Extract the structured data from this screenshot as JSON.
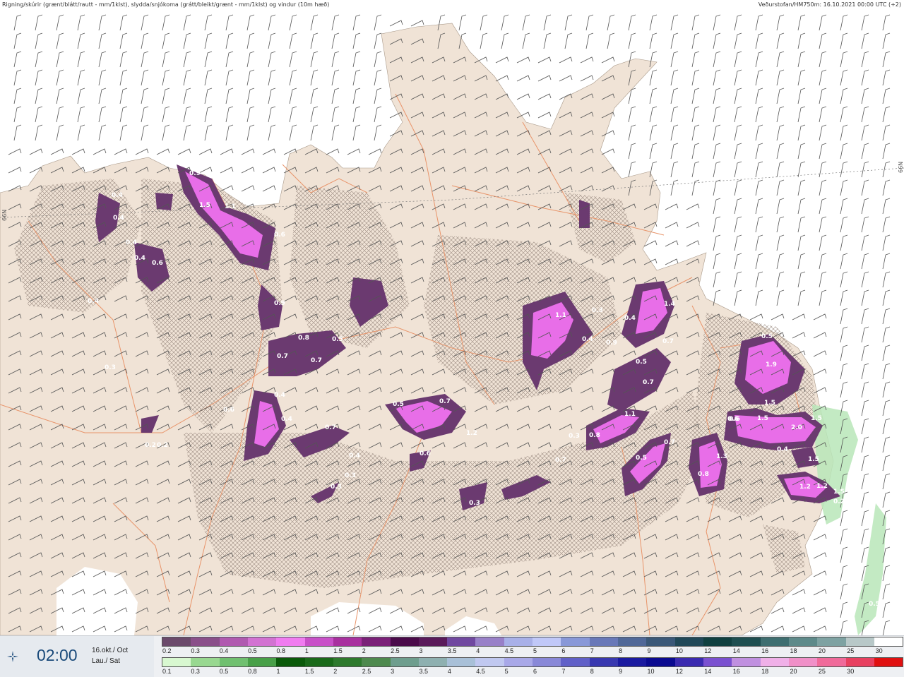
{
  "header": {
    "title": "Rigning/skúrir (grænt/blátt/rautt - mm/1klst), slydda/snjókoma (grátt/bleikt/grænt - mm/1klst) og vindur (10m hæð)",
    "source": "Veðurstofan/HM750m: 16.10.2021 00:00 UTC (+2)"
  },
  "map": {
    "lat_label_left": "66N",
    "lat_label_right": "66N",
    "colors": {
      "sea": "#ffffff",
      "land": "#f0e3d6",
      "roads": "#e8946a",
      "snow_purple": "#6b3a70",
      "snow_pink": "#e86ee8",
      "rain_green": "#b8e6b8"
    },
    "value_labels": [
      "0.9",
      "1.1",
      "0.4",
      "0.4",
      "0.4",
      "0.4",
      "0.6",
      "1.5",
      "0.6",
      "0.9",
      "0.8",
      "0.5",
      "0.7",
      "0.7",
      "0.4",
      "0.4",
      "0.7",
      "0.7",
      "0.5",
      "1.2",
      "0.6",
      "0.4",
      "0.3",
      "0.3",
      "0.3",
      "0.2",
      "0.2",
      "0.3",
      "0.4",
      "0.6",
      "1.1",
      "0.3",
      "0.4",
      "0.9",
      "0.5",
      "0.7",
      "0.8",
      "0.4",
      "1.4",
      "0.7",
      "0.5",
      "1.1",
      "0.7",
      "0.5",
      "0.4",
      "0.8",
      "0.3",
      "0.6",
      "1.3",
      "0.7",
      "1.9",
      "1.5",
      "2.0",
      "1.5",
      "0.6",
      "1.5",
      "1.2",
      "1.5",
      "1.2",
      "1.5",
      "0.5",
      "0.2"
    ]
  },
  "footer": {
    "time": "02:00",
    "date_line1": "16.okt./ Oct",
    "date_line2": "Lau./ Sat",
    "time_icon": "sun-burst-icon"
  },
  "scale_top": {
    "colors": [
      "#6b4a6b",
      "#8a4f8a",
      "#b05ab0",
      "#d272d2",
      "#f07cf0",
      "#c850c8",
      "#a8309f",
      "#7a2078",
      "#4a0a4a",
      "#5a1a5a",
      "#7048a0",
      "#9880c8",
      "#a8b0e8",
      "#c0c8f8",
      "#8898d8",
      "#6878b8",
      "#506898",
      "#3a5878",
      "#204858",
      "#104040",
      "#1e4e50",
      "#3e6e70",
      "#5e8a8a",
      "#7ea2a2",
      "#b8c8c8",
      "#ffffff"
    ],
    "labels": [
      "0.2",
      "0.3",
      "0.4",
      "0.5",
      "0.8",
      "1",
      "1.5",
      "2",
      "2.5",
      "3",
      "3.5",
      "4",
      "4.5",
      "5",
      "6",
      "7",
      "8",
      "9",
      "10",
      "12",
      "14",
      "16",
      "18",
      "20",
      "25",
      "30"
    ]
  },
  "scale_bottom": {
    "colors": [
      "#d8f8d0",
      "#98d890",
      "#70c070",
      "#48a048",
      "#0a5a0a",
      "#1a6a1a",
      "#2e7a2e",
      "#4e8a4e",
      "#6e9e8e",
      "#8eb0b0",
      "#a8c0d8",
      "#c0c8f0",
      "#a8a8e8",
      "#8888d8",
      "#6060c8",
      "#3838b0",
      "#1a1aa0",
      "#0a0a90",
      "#3a2ab0",
      "#7a50d0",
      "#c090e0",
      "#f0b0e8",
      "#f090c8",
      "#f06a9a",
      "#e84060",
      "#e01010"
    ],
    "labels": [
      "0.1",
      "0.3",
      "0.5",
      "0.8",
      "1",
      "1.5",
      "2",
      "2.5",
      "3",
      "3.5",
      "4",
      "4.5",
      "5",
      "6",
      "7",
      "8",
      "9",
      "10",
      "12",
      "14",
      "16",
      "18",
      "20",
      "25",
      "30"
    ]
  }
}
